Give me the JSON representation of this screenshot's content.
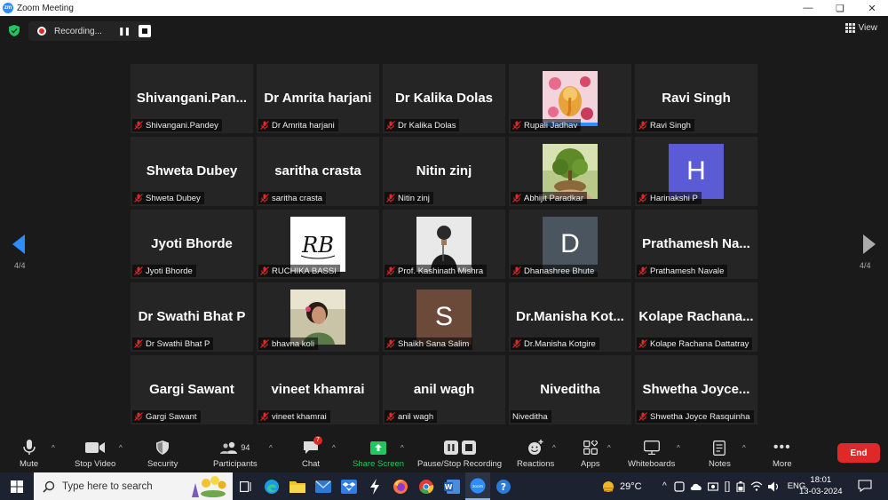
{
  "window": {
    "title": "Zoom Meeting",
    "logo": "zm"
  },
  "recording": {
    "label": "Recording..."
  },
  "view_label": "View",
  "page_indicator": {
    "left": "4/4",
    "right": "4/4"
  },
  "participants": [
    {
      "display": "Shivangani.Pan...",
      "name": "Shivangani.Pandey",
      "kind": "name"
    },
    {
      "display": "Dr Amrita harjani",
      "name": "Dr Amrita harjani",
      "kind": "name"
    },
    {
      "display": "Dr Kalika Dolas",
      "name": "Dr Kalika Dolas",
      "kind": "name"
    },
    {
      "display": "",
      "name": "Rupali Jadhav",
      "kind": "photo-ganesha"
    },
    {
      "display": "Ravi Singh",
      "name": "Ravi Singh",
      "kind": "name"
    },
    {
      "display": "Shweta Dubey",
      "name": "Shweta Dubey",
      "kind": "name"
    },
    {
      "display": "saritha crasta",
      "name": "saritha crasta",
      "kind": "name"
    },
    {
      "display": "Nitin zinj",
      "name": "Nitin zinj",
      "kind": "name"
    },
    {
      "display": "",
      "name": "Abhijit Paradkar",
      "kind": "photo-tree"
    },
    {
      "display": "H",
      "name": "Harinakshi P",
      "kind": "letter",
      "color": "#5b5bd6"
    },
    {
      "display": "Jyoti Bhorde",
      "name": "Jyoti Bhorde",
      "kind": "name"
    },
    {
      "display": "",
      "name": "RUCHIKA BASSI",
      "kind": "photo-rb"
    },
    {
      "display": "",
      "name": "Prof. Kashinath Mishra",
      "kind": "photo-person"
    },
    {
      "display": "D",
      "name": "Dhanashree Bhute",
      "kind": "letter",
      "color": "#4a5560"
    },
    {
      "display": "Prathamesh  Na...",
      "name": "Prathamesh Navale",
      "kind": "name"
    },
    {
      "display": "Dr Swathi Bhat P",
      "name": "Dr Swathi Bhat P",
      "kind": "name"
    },
    {
      "display": "",
      "name": "bhavna koli",
      "kind": "photo-woman"
    },
    {
      "display": "S",
      "name": "Shaikh Sana Salim",
      "kind": "letter",
      "color": "#6b4a3a"
    },
    {
      "display": "Dr.Manisha  Kot...",
      "name": "Dr.Manisha Kotgire",
      "kind": "name"
    },
    {
      "display": "Kolape  Rachana...",
      "name": "Kolape Rachana Dattatray",
      "kind": "name"
    },
    {
      "display": "Gargi Sawant",
      "name": "Gargi Sawant",
      "kind": "name"
    },
    {
      "display": "vineet khamrai",
      "name": "vineet khamrai",
      "kind": "name"
    },
    {
      "display": "anil wagh",
      "name": "anil wagh",
      "kind": "name"
    },
    {
      "display": "Niveditha",
      "name": "Niveditha",
      "kind": "name",
      "unmuted": true
    },
    {
      "display": "Shwetha  Joyce...",
      "name": "Shwetha Joyce Rasquinha",
      "kind": "name"
    }
  ],
  "toolbar": {
    "mute": "Mute",
    "stop_video": "Stop Video",
    "security": "Security",
    "participants": "Participants",
    "participants_count": "94",
    "chat": "Chat",
    "chat_badge": "7",
    "share_screen": "Share Screen",
    "pause_stop_recording": "Pause/Stop Recording",
    "reactions": "Reactions",
    "apps": "Apps",
    "whiteboards": "Whiteboards",
    "notes": "Notes",
    "more": "More",
    "end": "End"
  },
  "taskbar": {
    "search_placeholder": "Type here to search",
    "weather": "29°C",
    "language": "ENG",
    "time": "18:01",
    "date": "13-03-2024"
  },
  "colors": {
    "accent": "#2d8cff",
    "end": "#e02828",
    "share": "#22c55e"
  }
}
